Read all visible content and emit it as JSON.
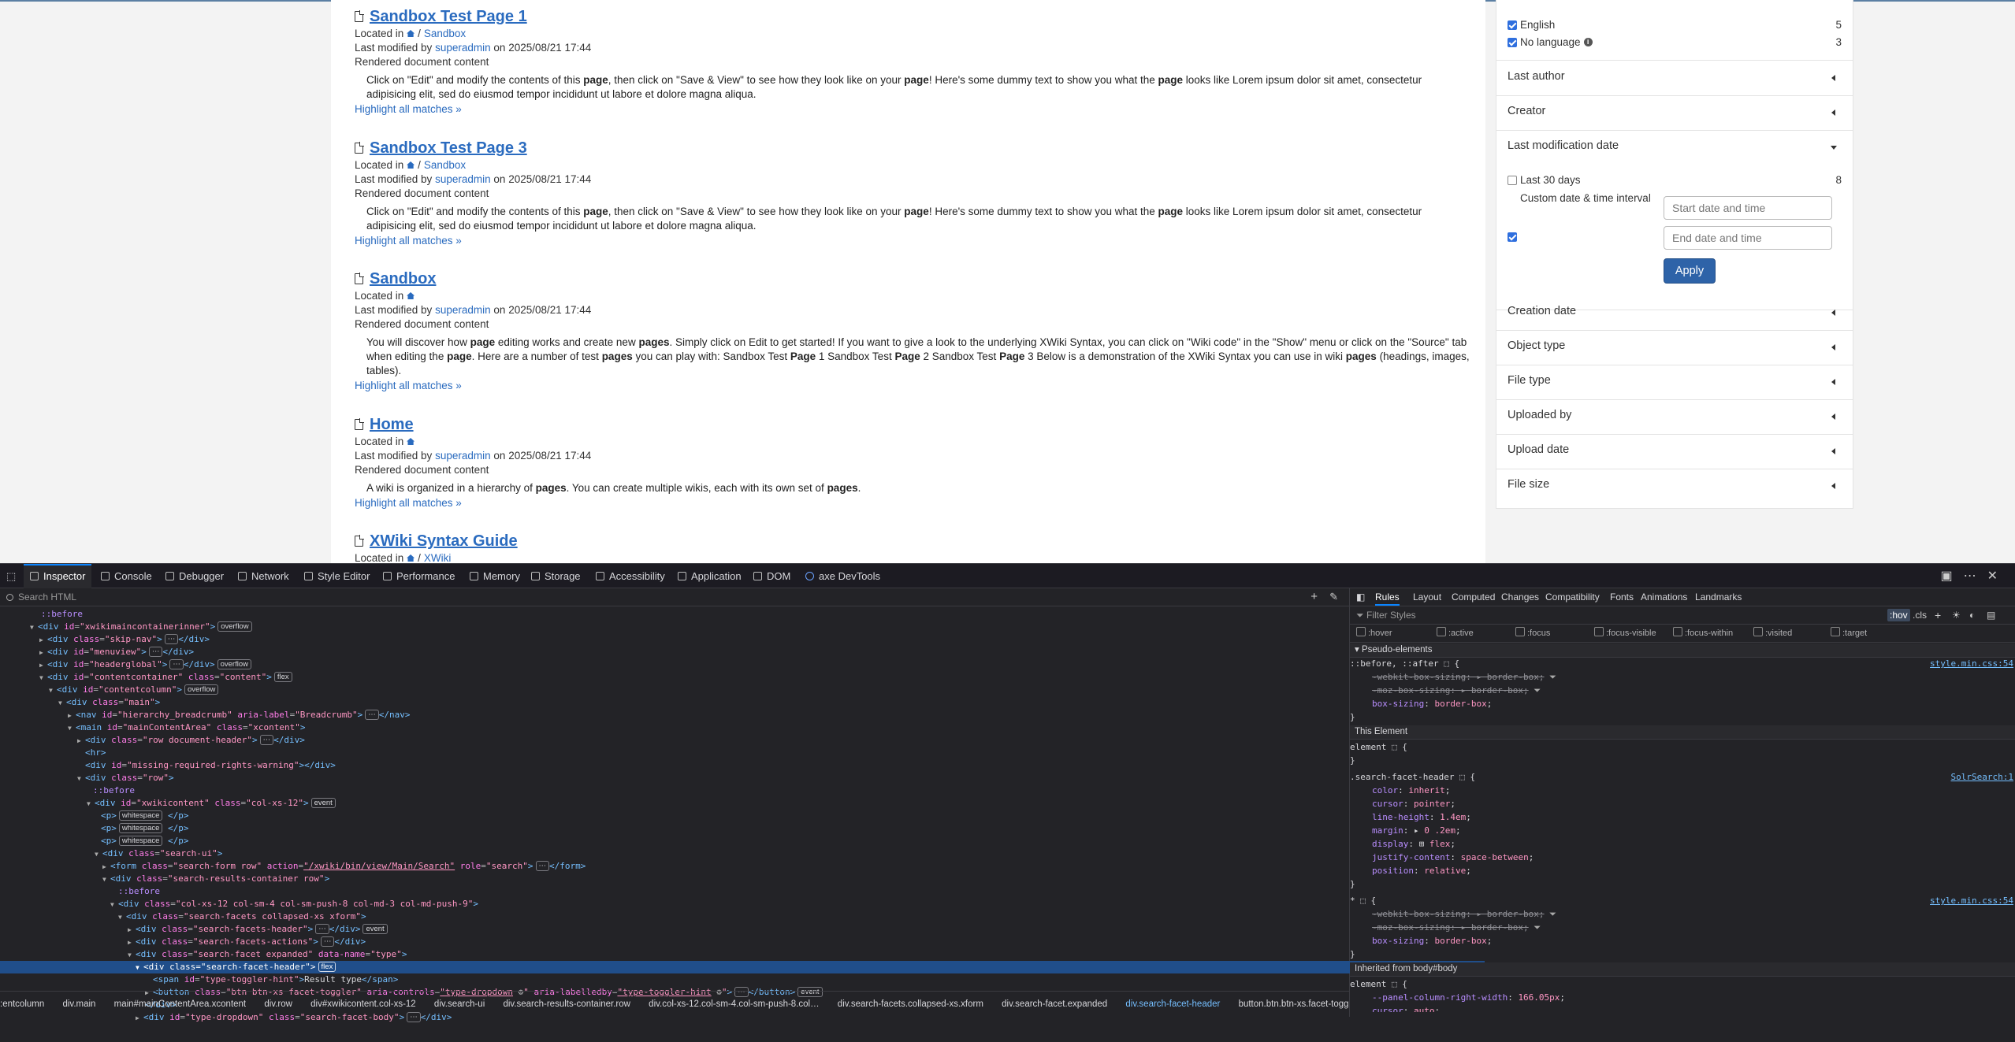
{
  "results": [
    {
      "title": "Sandbox Test Page 1",
      "located_in_label": "Located in",
      "location_path": [
        "Sandbox"
      ],
      "modified_label": "Last modified by",
      "author": "superadmin",
      "on_label": "on",
      "date": "2025/08/21 17:44",
      "content_label": "Rendered document content",
      "snippet_html": "Click on \"Edit\" and modify the contents of this <b>page</b>, then click on \"Save &amp; View\" to see how they look like on your <b>page</b>! Here's some dummy text to show you what the <b>page</b> looks like Lorem ipsum dolor sit amet, consectetur adipisicing elit, sed do eiusmod tempor incididunt ut labore et dolore magna aliqua.",
      "highlight": "Highlight all matches »"
    },
    {
      "title": "Sandbox Test Page 3",
      "located_in_label": "Located in",
      "location_path": [
        "Sandbox"
      ],
      "modified_label": "Last modified by",
      "author": "superadmin",
      "on_label": "on",
      "date": "2025/08/21 17:44",
      "content_label": "Rendered document content",
      "snippet_html": "Click on \"Edit\" and modify the contents of this <b>page</b>, then click on \"Save &amp; View\" to see how they look like on your <b>page</b>! Here's some dummy text to show you what the <b>page</b> looks like Lorem ipsum dolor sit amet, consectetur adipisicing elit, sed do eiusmod tempor incididunt ut labore et dolore magna aliqua.",
      "highlight": "Highlight all matches »"
    },
    {
      "title": "Sandbox",
      "located_in_label": "Located in",
      "location_path": [],
      "modified_label": "Last modified by",
      "author": "superadmin",
      "on_label": "on",
      "date": "2025/08/21 17:44",
      "content_label": "Rendered document content",
      "snippet_html": "You will discover how <b>page</b> editing works and create new <b>pages</b>. Simply click on Edit to get started! If you want to give a look to the underlying XWiki Syntax, you can click on \"Wiki code\" in the \"Show\" menu or click on the \"Source\" tab when editing the <b>page</b>. Here are a number of test <b>pages</b> you can play with: Sandbox Test <b>Page</b> 1 Sandbox Test <b>Page</b> 2 Sandbox Test <b>Page</b> 3 Below is a demonstration of the XWiki Syntax you can use in wiki <b>pages</b> (headings, images, tables).",
      "highlight": "Highlight all matches »"
    },
    {
      "title": "Home",
      "located_in_label": "Located in",
      "location_path": [],
      "modified_label": "Last modified by",
      "author": "superadmin",
      "on_label": "on",
      "date": "2025/08/21 17:44",
      "content_label": "Rendered document content",
      "snippet_html": "A wiki is organized in a hierarchy of <b>pages</b>. You can create multiple wikis, each with its own set of <b>pages</b>.",
      "highlight": "Highlight all matches »"
    },
    {
      "title": "XWiki Syntax Guide",
      "located_in_label": "Located in",
      "location_path": [
        "XWiki"
      ]
    }
  ],
  "facets": {
    "language_options": [
      {
        "label": "English",
        "count": "5",
        "checked": true
      },
      {
        "label": "No language",
        "count": "3",
        "checked": true
      }
    ],
    "headers": [
      "Last author",
      "Creator",
      "Last modification date",
      "Creation date",
      "Object type",
      "File type",
      "Uploaded by",
      "Upload date",
      "File size"
    ],
    "last30_label": "Last 30 days",
    "last30_count": "8",
    "custom_interval_label": "Custom date & time interval",
    "start_placeholder": "Start date and time",
    "end_placeholder": "End date and time",
    "apply_label": "Apply"
  },
  "devtools": {
    "tabs": [
      "Inspector",
      "Console",
      "Debugger",
      "Network",
      "Style Editor",
      "Performance",
      "Memory",
      "Storage",
      "Accessibility",
      "Application",
      "DOM",
      "axe DevTools"
    ],
    "search_placeholder": "Search HTML",
    "breadcrumbs": [
      ":entcolumn",
      "div.main",
      "main#mainContentArea.xcontent",
      "div.row",
      "div#xwikicontent.col-xs-12",
      "div.search-ui",
      "div.search-results-container.row",
      "div.col-xs-12.col-sm-4.col-sm-push-8.col…",
      "div.search-facets.collapsed-xs.xform",
      "div.search-facet.expanded",
      "div.search-facet-header",
      "button.btn.btn-xs.facet-toggler"
    ],
    "rules_tabs": [
      "Rules",
      "Layout",
      "Computed",
      "Changes",
      "Compatibility",
      "Fonts",
      "Animations",
      "Landmarks"
    ],
    "filter_placeholder": "Filter Styles",
    "hov": ":hov",
    "cls": ".cls",
    "pseudo_classes": [
      ":hover",
      ":active",
      ":focus",
      ":focus-visible",
      ":focus-within",
      ":visited",
      ":target"
    ],
    "rules": {
      "pseudo_elements_label": "Pseudo-elements",
      "pseudo_selector": "::before, ::after",
      "this_element_label": "This Element",
      "element_label": "element",
      "facet_header_selector": ".search-facet-header",
      "star_selector": "*",
      "inherited_label": "Inherited from body#body",
      "src_style": "style.min.css:54",
      "src_solr": "SolrSearch:1"
    }
  }
}
